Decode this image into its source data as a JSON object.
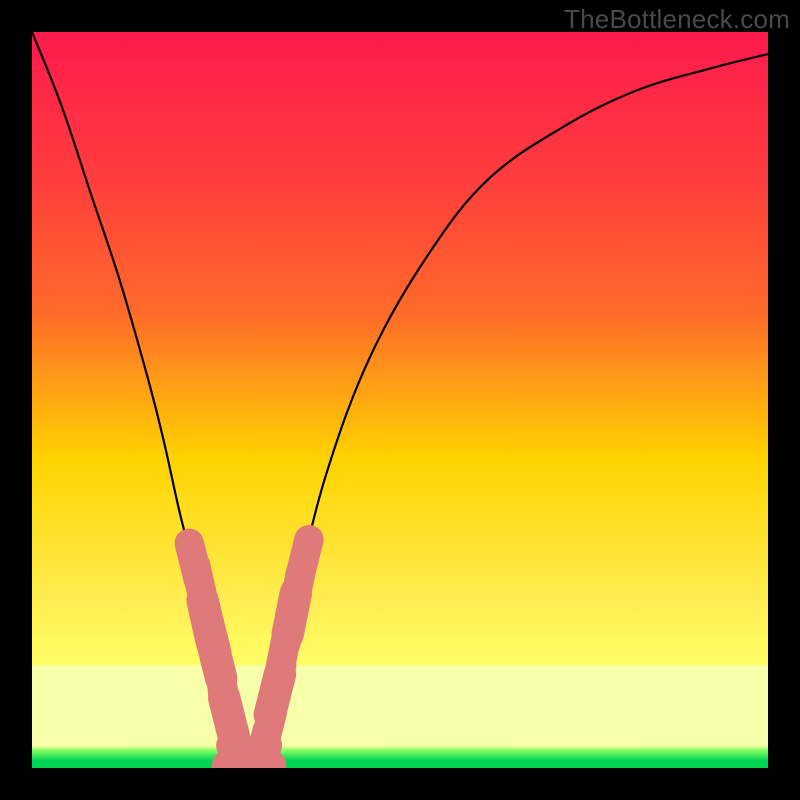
{
  "watermark": "TheBottleneck.com",
  "colors": {
    "frame_bg": "#000000",
    "watermark": "#4a4a4a",
    "gradient_top": "#ff1a4d",
    "gradient_mid1": "#ff6a2a",
    "gradient_mid2": "#ffd300",
    "gradient_mid3": "#ffff66",
    "gradient_bottom_band": "#f7ffa8",
    "gradient_green_light": "#8fff66",
    "gradient_green": "#00d455",
    "curve_stroke": "#000000",
    "dot_fill": "#e07a7a"
  },
  "chart_data": {
    "type": "line",
    "title": "",
    "xlabel": "",
    "ylabel": "",
    "xlim": [
      0,
      100
    ],
    "ylim": [
      0,
      100
    ],
    "curve": {
      "name": "V/asymmetric-valley",
      "x": [
        0,
        4,
        8,
        12,
        16,
        18,
        20,
        22,
        24,
        26,
        27,
        28,
        29,
        30,
        31,
        32,
        34,
        36,
        40,
        46,
        54,
        62,
        72,
        82,
        92,
        100
      ],
      "y": [
        100,
        90,
        78,
        66,
        52,
        44,
        35,
        27,
        18,
        10,
        6,
        2,
        0,
        0,
        2,
        6,
        14,
        24,
        40,
        56,
        70,
        80,
        87,
        92,
        95,
        97
      ]
    },
    "dots": {
      "name": "data-points",
      "series": [
        {
          "x": 22.0,
          "y": 28.0,
          "r": 2.0
        },
        {
          "x": 22.8,
          "y": 25.0,
          "r": 2.0
        },
        {
          "x": 23.8,
          "y": 20.0,
          "r": 2.2
        },
        {
          "x": 24.2,
          "y": 18.5,
          "r": 2.2
        },
        {
          "x": 25.0,
          "y": 15.0,
          "r": 2.2
        },
        {
          "x": 25.3,
          "y": 13.5,
          "r": 2.0
        },
        {
          "x": 26.0,
          "y": 10.5,
          "r": 2.0
        },
        {
          "x": 26.5,
          "y": 8.0,
          "r": 2.0
        },
        {
          "x": 26.8,
          "y": 6.8,
          "r": 2.2
        },
        {
          "x": 27.5,
          "y": 3.5,
          "r": 2.0
        },
        {
          "x": 27.8,
          "y": 2.3,
          "r": 2.0
        },
        {
          "x": 28.5,
          "y": 0.5,
          "r": 2.2
        },
        {
          "x": 29.5,
          "y": 0.3,
          "r": 2.2
        },
        {
          "x": 30.5,
          "y": 0.5,
          "r": 2.2
        },
        {
          "x": 31.3,
          "y": 2.5,
          "r": 2.0
        },
        {
          "x": 32.0,
          "y": 5.0,
          "r": 2.0
        },
        {
          "x": 33.0,
          "y": 10.0,
          "r": 2.2
        },
        {
          "x": 33.3,
          "y": 11.5,
          "r": 2.0
        },
        {
          "x": 34.2,
          "y": 16.0,
          "r": 2.0
        },
        {
          "x": 35.0,
          "y": 19.5,
          "r": 2.0
        },
        {
          "x": 35.3,
          "y": 21.0,
          "r": 2.2
        },
        {
          "x": 36.0,
          "y": 24.0,
          "r": 2.0
        },
        {
          "x": 37.0,
          "y": 28.5,
          "r": 2.0
        }
      ]
    },
    "gradient_bands_y": {
      "pale_yellow_band_top": 14,
      "green_fade_top": 3,
      "full_green_top": 1
    }
  }
}
